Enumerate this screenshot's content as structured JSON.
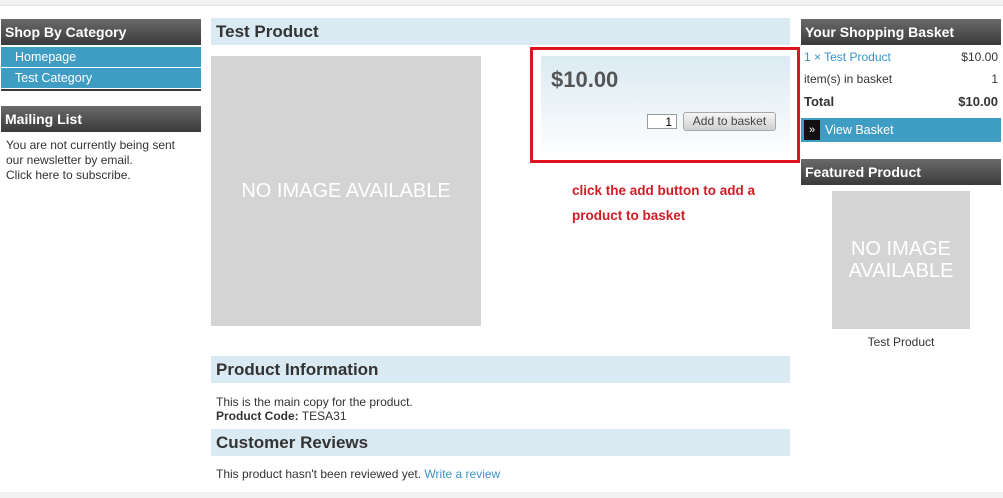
{
  "sidebar_left": {
    "category": {
      "title": "Shop By Category",
      "items": [
        "Homepage",
        "Test Category"
      ]
    },
    "mailing": {
      "title": "Mailing List",
      "text_line1": "You are not currently being sent",
      "text_line2": "our newsletter by email.",
      "link": "Click here to subscribe."
    }
  },
  "product": {
    "title": "Test Product",
    "image_placeholder": "NO IMAGE AVAILABLE",
    "price": "$10.00",
    "quantity": "1",
    "add_button": "Add to basket"
  },
  "annotation": {
    "line1": "click the add button to add a",
    "line2": "product to basket"
  },
  "info": {
    "title": "Product Information",
    "copy": "This is the main copy for the product.",
    "code_label": "Product Code:",
    "code_value": "TESA31"
  },
  "reviews": {
    "title": "Customer Reviews",
    "text": "This product hasn't been reviewed yet.",
    "link": "Write a review"
  },
  "basket": {
    "title": "Your Shopping Basket",
    "line_item": "1 × Test Product",
    "line_price": "$10.00",
    "items_label": "item(s) in basket",
    "items_count": "1",
    "total_label": "Total",
    "total_value": "$10.00",
    "view_arrow": "»",
    "view_label": "View Basket"
  },
  "featured": {
    "title": "Featured Product",
    "image_line1": "NO IMAGE",
    "image_line2": "AVAILABLE",
    "name": "Test Product"
  },
  "colors": {
    "accent_blue": "#3f9dc3",
    "link_blue": "#3a94c9",
    "section_bg": "#daeaf2",
    "annotation_red": "#e0141e"
  }
}
